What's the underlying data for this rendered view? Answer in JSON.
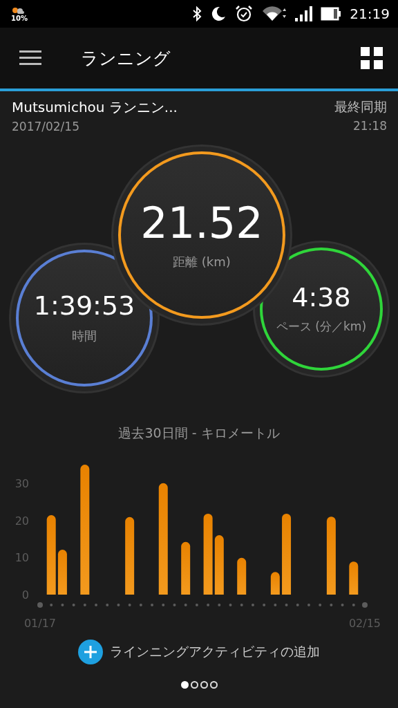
{
  "status_bar": {
    "weather": "10%",
    "time": "21:19"
  },
  "app_bar": {
    "title": "ランニング"
  },
  "activity": {
    "name": "Mutsumichou ランニン...",
    "date": "2017/02/15",
    "sync_label": "最終同期",
    "sync_time": "21:18"
  },
  "gauges": [
    {
      "value": "21.52",
      "label": "距離 (km)",
      "color": "#f39a1e"
    },
    {
      "value": "1:39:53",
      "label": "時間",
      "color": "#5a7fd4"
    },
    {
      "value": "4:38",
      "label": "ペース (分／km)",
      "color": "#2fd53a"
    }
  ],
  "chart": {
    "chart_data": {
      "type": "bar",
      "title": "過去30日間 - キロメートル",
      "categories": [
        "01/17",
        null,
        null,
        null,
        null,
        null,
        null,
        null,
        null,
        null,
        null,
        null,
        null,
        null,
        null,
        null,
        null,
        null,
        null,
        null,
        null,
        null,
        null,
        null,
        null,
        null,
        null,
        null,
        null,
        "02/15"
      ],
      "values": [
        null,
        21.4,
        12.1,
        null,
        35.0,
        null,
        null,
        null,
        20.9,
        null,
        null,
        30.0,
        null,
        14.2,
        null,
        21.8,
        16.0,
        null,
        9.9,
        null,
        null,
        6.1,
        21.8,
        null,
        null,
        null,
        21.0,
        null,
        8.9,
        null
      ],
      "yticks": [
        0,
        10,
        20,
        30
      ],
      "ylim": [
        0,
        35
      ],
      "color": "#f39a1e"
    }
  },
  "add_action": {
    "label": "ラインニングアクティビティの追加"
  },
  "pages": [
    {
      "selected": true
    },
    {
      "selected": false
    },
    {
      "selected": false
    },
    {
      "selected": false
    }
  ]
}
